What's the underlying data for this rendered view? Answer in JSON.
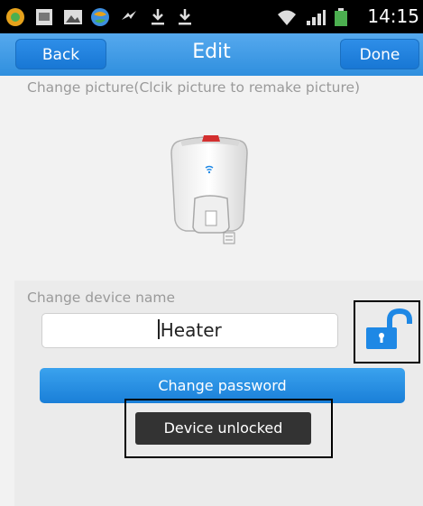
{
  "status_bar": {
    "time": "14:15",
    "icons": [
      "app-icon",
      "sim-icon",
      "gallery-icon",
      "browser-icon",
      "usb-icon",
      "download-icon",
      "download-icon",
      "wifi-icon",
      "signal-icon",
      "battery-icon"
    ]
  },
  "header": {
    "back_label": "Back",
    "title": "Edit",
    "done_label": "Done"
  },
  "picture": {
    "hint": "Change picture(Clcik picture to remake picture)"
  },
  "device": {
    "name_label": "Change device name",
    "name_value": "Heater",
    "change_password_label": "Change password"
  },
  "toast": {
    "message": "Device unlocked"
  },
  "colors": {
    "accent": "#2f8fde",
    "button": "#1a7fd8",
    "lock_icon": "#1e88e5"
  }
}
